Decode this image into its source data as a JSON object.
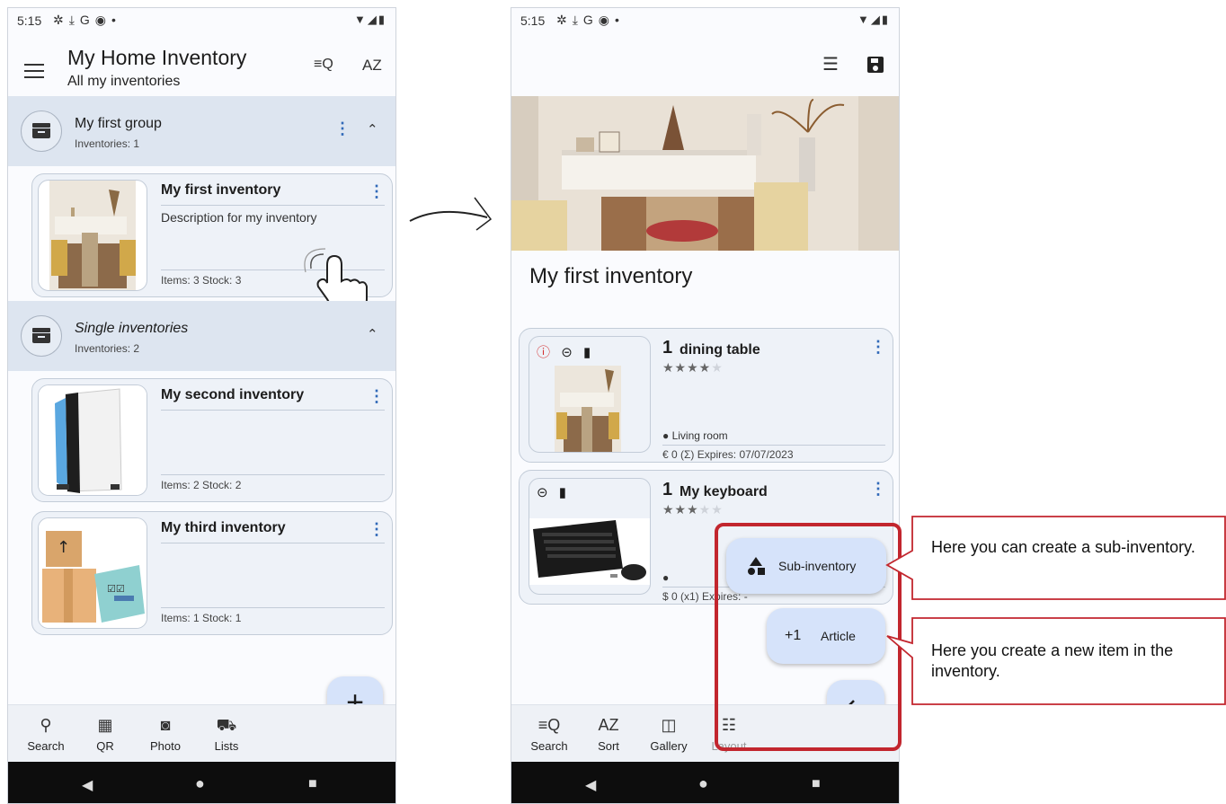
{
  "left_phone": {
    "status": {
      "time": "5:15"
    },
    "app_title": "My Home Inventory",
    "app_subtitle": "All my inventories",
    "groups": [
      {
        "title": "My first group",
        "count": "Inventories: 1"
      },
      {
        "title": "Single inventories",
        "count": "Inventories: 2"
      }
    ],
    "inventories": [
      {
        "name": "My first inventory",
        "description": "Description for my inventory",
        "stats": "Items: 3   Stock: 3"
      },
      {
        "name": "My second inventory",
        "description": "",
        "stats": "Items: 2   Stock: 2"
      },
      {
        "name": "My third inventory",
        "description": "",
        "stats": "Items: 1   Stock: 1"
      }
    ],
    "fab_icon": "+",
    "bottom_nav": [
      {
        "label": "Search",
        "icon": "search-icon"
      },
      {
        "label": "QR",
        "icon": "qr-icon"
      },
      {
        "label": "Photo",
        "icon": "camera-icon"
      },
      {
        "label": "Lists",
        "icon": "cart-icon"
      }
    ]
  },
  "right_phone": {
    "status": {
      "time": "5:15"
    },
    "inventory_title": "My first inventory",
    "items": [
      {
        "qty": "1",
        "name": "dining table",
        "rating": 4,
        "location": "Living room",
        "price": "€ 0  (Σ)   Expires: 07/07/2023"
      },
      {
        "qty": "1",
        "name": "My keyboard",
        "rating": 3,
        "location": "",
        "price": "$ 0  (x1)   Expires: -"
      }
    ],
    "fab_sub_inventory": "Sub-inventory",
    "fab_article_prefix": "+1",
    "fab_article": "Article",
    "bottom_nav": [
      {
        "label": "Search",
        "icon": "filter-search-icon"
      },
      {
        "label": "Sort",
        "icon": "sort-az-icon"
      },
      {
        "label": "Gallery",
        "icon": "gallery-icon"
      },
      {
        "label": "Layout",
        "icon": "layout-icon"
      }
    ]
  },
  "callouts": [
    {
      "text": "Here you can create a sub-inventory."
    },
    {
      "text": "Here you create a new item in the inventory."
    }
  ],
  "colors": {
    "accent": "#3069b8",
    "highlight": "#c2262e",
    "group_bg": "#dde5f0",
    "fab_bg": "#d6e3fa"
  }
}
